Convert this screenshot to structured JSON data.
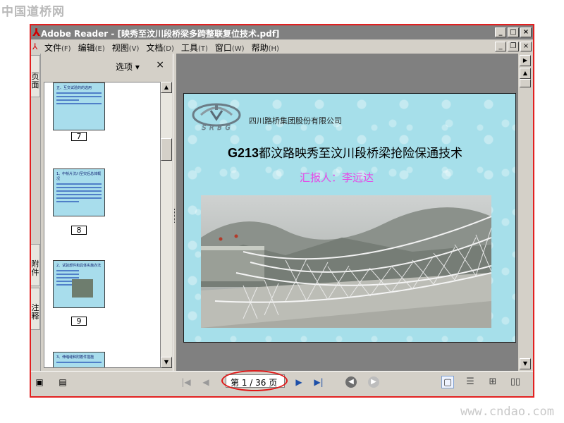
{
  "site": {
    "logo_text": "中国道桥网",
    "url_text": "www.cndao.com"
  },
  "window": {
    "title": "Adobe Reader - [映秀至汶川段桥梁多跨整联复位技术.pdf]",
    "app_icon": "adobe-reader-icon",
    "controls": [
      "_",
      "□",
      "×"
    ],
    "doc_controls": [
      "_",
      "❐",
      "×"
    ]
  },
  "menu": [
    {
      "label": "文件",
      "acc": "(F)"
    },
    {
      "label": "编辑",
      "acc": "(E)"
    },
    {
      "label": "视图",
      "acc": "(V)"
    },
    {
      "label": "文档",
      "acc": "(D)"
    },
    {
      "label": "工具",
      "acc": "(T)"
    },
    {
      "label": "窗口",
      "acc": "(W)"
    },
    {
      "label": "帮助",
      "acc": "(H)"
    }
  ],
  "left_tabs": {
    "pages": "页面",
    "attachments": "附件",
    "comments": "注释"
  },
  "panel": {
    "options_label": "选项 ▾",
    "close_label": "×",
    "thumbnails": [
      {
        "page": "7",
        "title": "五、互交试验的的选用"
      },
      {
        "page": "8",
        "title": "1、中桥片汶川至灾后总体概况"
      },
      {
        "page": "9",
        "title": "2、试验部件和具体实施办法"
      },
      {
        "page": "",
        "title": "3、伸缩缝和附着件措施"
      }
    ]
  },
  "slide": {
    "company": "四川路桥集团股份有限公司",
    "logo_letters": "SRBG",
    "title_prefix": "G213",
    "title_rest": "都汶路映秀至汶川段桥梁抢险保通技术",
    "reporter": "汇报人：李远达",
    "colors": {
      "background": "#a6dfea",
      "reporter": "#e64ae6"
    }
  },
  "statusbar": {
    "page_display": "第 1 / 36 页",
    "current_page": 1,
    "total_pages": 36,
    "nav": [
      "first-page-icon",
      "prev-page-icon",
      "next-page-icon",
      "last-page-icon"
    ],
    "history": [
      "back-icon",
      "forward-icon"
    ],
    "layouts": [
      "single-page-icon",
      "continuous-icon",
      "facing-icon",
      "continuous-facing-icon"
    ]
  }
}
